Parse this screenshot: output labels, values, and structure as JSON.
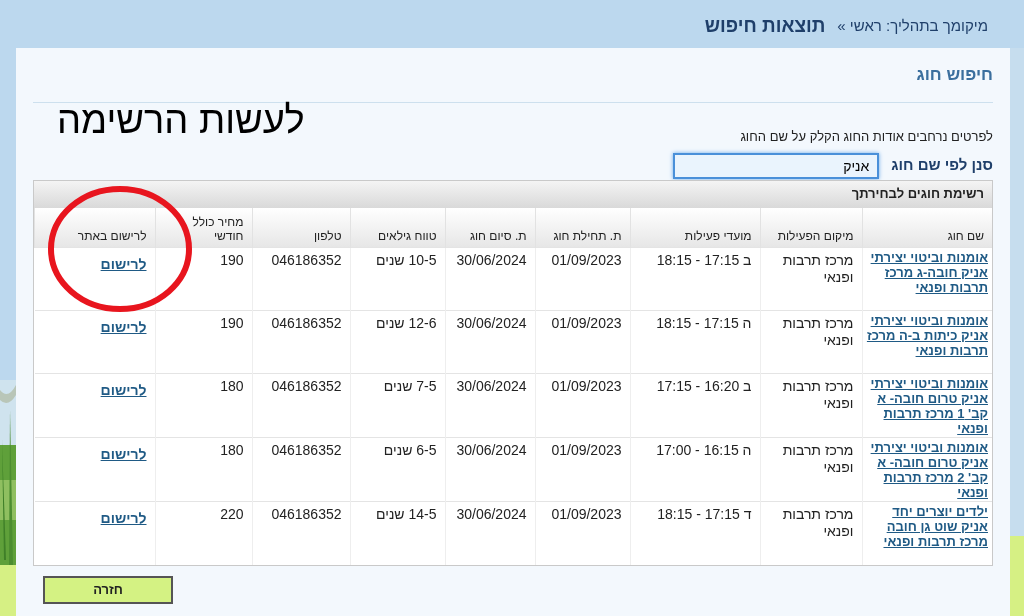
{
  "breadcrumb": {
    "trail": "מיקומך בתהליך: ראשי »",
    "current": "תוצאות חיפוש"
  },
  "section_title": "חיפוש חוג",
  "annotation": {
    "text": "לעשות הרשימה"
  },
  "hint": "לפרטים נרחבים אודות החוג הקלק על שם החוג",
  "filter": {
    "label": "סנן לפי שם חוג",
    "value": "אניק"
  },
  "table": {
    "caption": "רשימת חוגים לבחירתך",
    "columns": [
      "שם חוג",
      "מיקום הפעילות",
      "מועדי פעילות",
      "ת. תחילת חוג",
      "ת. סיום חוג",
      "טווח גילאים",
      "טלפון",
      "מחיר כולל חודשי",
      "לרישום באתר"
    ],
    "rows": [
      {
        "name": "אומנות וביטוי יצירתי אניק חובה-ג מרכז תרבות ופנאי",
        "location": "מרכז תרבות ופנאי",
        "schedule": "ב 17:15 - 18:15",
        "start": "01/09/2023",
        "end": "30/06/2024",
        "ages": "10-5 שנים",
        "phone": "046186352",
        "price": "190",
        "register": "לרישום"
      },
      {
        "name": "אומנות וביטוי יצירתי אניק כיתות ב-ה מרכז תרבות ופנאי",
        "location": "מרכז תרבות ופנאי",
        "schedule": "ה 17:15 - 18:15",
        "start": "01/09/2023",
        "end": "30/06/2024",
        "ages": "12-6 שנים",
        "phone": "046186352",
        "price": "190",
        "register": "לרישום"
      },
      {
        "name": "אומנות וביטוי יצירתי אניק טרום חובה- א קב' 1 מרכז תרבות ופנאי",
        "location": "מרכז תרבות ופנאי",
        "schedule": "ב 16:20 - 17:15",
        "start": "01/09/2023",
        "end": "30/06/2024",
        "ages": "7-5 שנים",
        "phone": "046186352",
        "price": "180",
        "register": "לרישום"
      },
      {
        "name": "אומנות וביטוי יצירתי אניק טרום חובה- א קב' 2 מרכז תרבות ופנאי",
        "location": "מרכז תרבות ופנאי",
        "schedule": "ה 16:15 - 17:00",
        "start": "01/09/2023",
        "end": "30/06/2024",
        "ages": "6-5 שנים",
        "phone": "046186352",
        "price": "180",
        "register": "לרישום"
      },
      {
        "name": "ילדים יוצרים יחד אניק שוט גן חובה מרכז תרבות ופנאי",
        "location": "מרכז תרבות ופנאי",
        "schedule": "ד 17:15 - 18:15",
        "start": "01/09/2023",
        "end": "30/06/2024",
        "ages": "14-5 שנים",
        "phone": "046186352",
        "price": "220",
        "register": "לרישום"
      }
    ]
  },
  "back_button": "חזרה"
}
